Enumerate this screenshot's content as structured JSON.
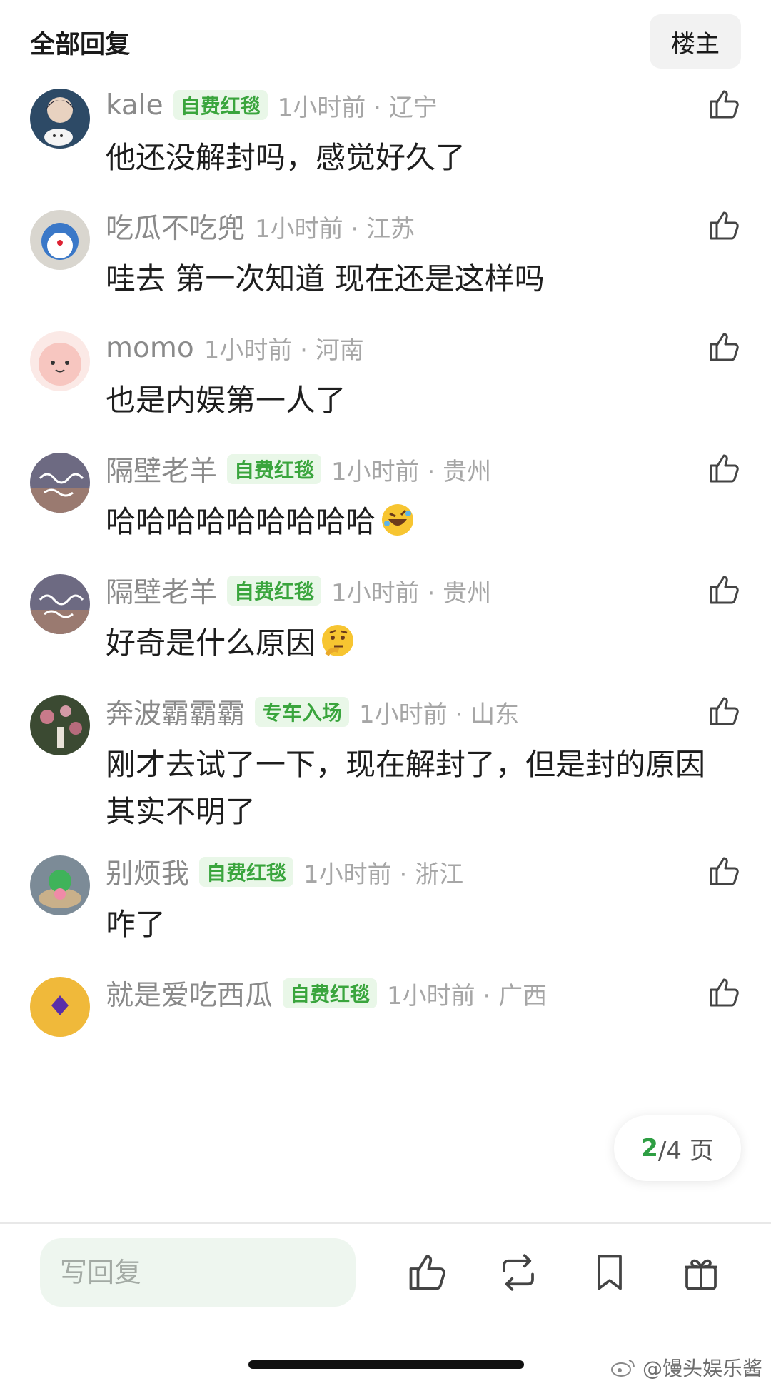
{
  "header": {
    "title": "全部回复",
    "owner_button": "楼主"
  },
  "comments": [
    {
      "username": "kale",
      "badge": "自费红毯",
      "time": "1小时前 · 辽宁",
      "text": "他还没解封吗，感觉好久了"
    },
    {
      "username": "吃瓜不吃兜",
      "badge": "",
      "time": "1小时前 · 江苏",
      "text": "哇去 第一次知道 现在还是这样吗"
    },
    {
      "username": "momo",
      "badge": "",
      "time": "1小时前 · 河南",
      "text": "也是内娱第一人了"
    },
    {
      "username": "隔壁老羊",
      "badge": "自费红毯",
      "time": "1小时前 · 贵州",
      "text": "哈哈哈哈哈哈哈哈哈",
      "emoji": "rolling-laughing-emoji"
    },
    {
      "username": "隔壁老羊",
      "badge": "自费红毯",
      "time": "1小时前 · 贵州",
      "text": "好奇是什么原因",
      "emoji": "thinking-face-emoji"
    },
    {
      "username": "奔波霸霸霸",
      "badge": "专车入场",
      "time": "1小时前 · 山东",
      "text": "刚才去试了一下，现在解封了，但是封的原因其实不明了"
    },
    {
      "username": "别烦我",
      "badge": "自费红毯",
      "time": "1小时前 · 浙江",
      "text": "咋了"
    },
    {
      "username": "就是爱吃西瓜",
      "badge": "自费红毯",
      "time": "1小时前 · 广西",
      "text": ""
    }
  ],
  "pager": {
    "current": "2",
    "total_text": "/4 页"
  },
  "bottom_bar": {
    "reply_placeholder": "写回复"
  },
  "watermark": "@馒头娱乐酱",
  "colors": {
    "badge_text": "#3aa53d",
    "badge_bg": "#e9f7e8",
    "pager_current": "#2e9e43",
    "reply_bg": "#eef6ef"
  }
}
